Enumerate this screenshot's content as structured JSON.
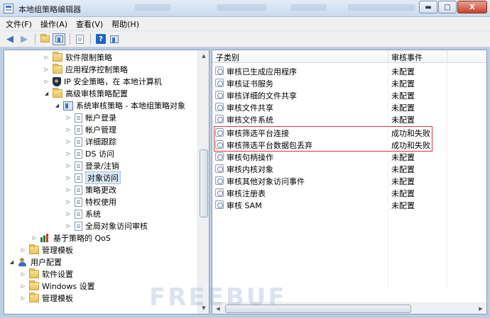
{
  "window": {
    "title": "本地组策略编辑器",
    "close_glyph": "X",
    "minimize_glyph": "▬",
    "maximize_glyph": "□"
  },
  "menu": [
    "文件(F)",
    "操作(A)",
    "查看(V)",
    "帮助(H)"
  ],
  "toolbar": {
    "icons": [
      "back-arrow-icon",
      "forward-arrow-icon",
      "up-folder-icon",
      "show-hide-tree-icon",
      "export-list-icon",
      "help-icon",
      "properties-icon"
    ],
    "help_glyph": "?"
  },
  "tree": {
    "items": [
      {
        "label": "软件限制策略",
        "icon": "folder",
        "expand": "collapsed"
      },
      {
        "label": "应用程序控制策略",
        "icon": "folder",
        "expand": "collapsed"
      },
      {
        "label": "IP 安全策略，在 本地计算机",
        "icon": "shield",
        "expand": "collapsed"
      },
      {
        "label": "高级审核策略配置",
        "icon": "folder",
        "expand": "expanded"
      },
      {
        "label": "系统审核策略 - 本地组策略对象",
        "icon": "policy",
        "expand": "expanded"
      },
      {
        "label": "帐户登录",
        "icon": "doc",
        "expand": "collapsed"
      },
      {
        "label": "帐户管理",
        "icon": "doc",
        "expand": "collapsed"
      },
      {
        "label": "详细跟踪",
        "icon": "doc",
        "expand": "collapsed"
      },
      {
        "label": "DS 访问",
        "icon": "doc",
        "expand": "collapsed"
      },
      {
        "label": "登录/注销",
        "icon": "doc",
        "expand": "collapsed"
      },
      {
        "label": "对象访问",
        "icon": "doc",
        "expand": "collapsed",
        "selected": true
      },
      {
        "label": "策略更改",
        "icon": "doc",
        "expand": "collapsed"
      },
      {
        "label": "特权使用",
        "icon": "doc",
        "expand": "collapsed"
      },
      {
        "label": "系统",
        "icon": "doc",
        "expand": "collapsed"
      },
      {
        "label": "全局对象访问审核",
        "icon": "doc",
        "expand": "collapsed"
      },
      {
        "label": "基于策略的 QoS",
        "icon": "qos",
        "expand": "collapsed"
      },
      {
        "label": "管理模板",
        "icon": "folder",
        "expand": "collapsed"
      },
      {
        "label": "用户配置",
        "icon": "users",
        "expand": "expanded"
      },
      {
        "label": "软件设置",
        "icon": "folder",
        "expand": "collapsed"
      },
      {
        "label": "Windows 设置",
        "icon": "folder",
        "expand": "collapsed"
      },
      {
        "label": "管理模板",
        "icon": "folder",
        "expand": "collapsed"
      }
    ]
  },
  "list": {
    "columns": [
      "子类别",
      "审核事件"
    ],
    "rows": [
      {
        "name": "审核已生成应用程序",
        "status": "未配置"
      },
      {
        "name": "审核证书服务",
        "status": "未配置"
      },
      {
        "name": "审核详细的文件共享",
        "status": "未配置"
      },
      {
        "name": "审核文件共享",
        "status": "未配置"
      },
      {
        "name": "审核文件系统",
        "status": "未配置"
      },
      {
        "name": "审核筛选平台连接",
        "status": "成功和失败"
      },
      {
        "name": "审核筛选平台数据包丢弃",
        "status": "成功和失败"
      },
      {
        "name": "审核句柄操作",
        "status": "未配置"
      },
      {
        "name": "审核内核对象",
        "status": "未配置"
      },
      {
        "name": "审核其他对象访问事件",
        "status": "未配置"
      },
      {
        "name": "审核注册表",
        "status": "未配置"
      },
      {
        "name": "审核 SAM",
        "status": "未配置"
      }
    ]
  },
  "scroll_glyphs": {
    "up": "▲",
    "down": "▼",
    "left": "◀",
    "right": "▶"
  },
  "watermark": "FREEBUF",
  "colors": {
    "highlight_border": "#e0323c",
    "selection": "#dbe6f4"
  }
}
